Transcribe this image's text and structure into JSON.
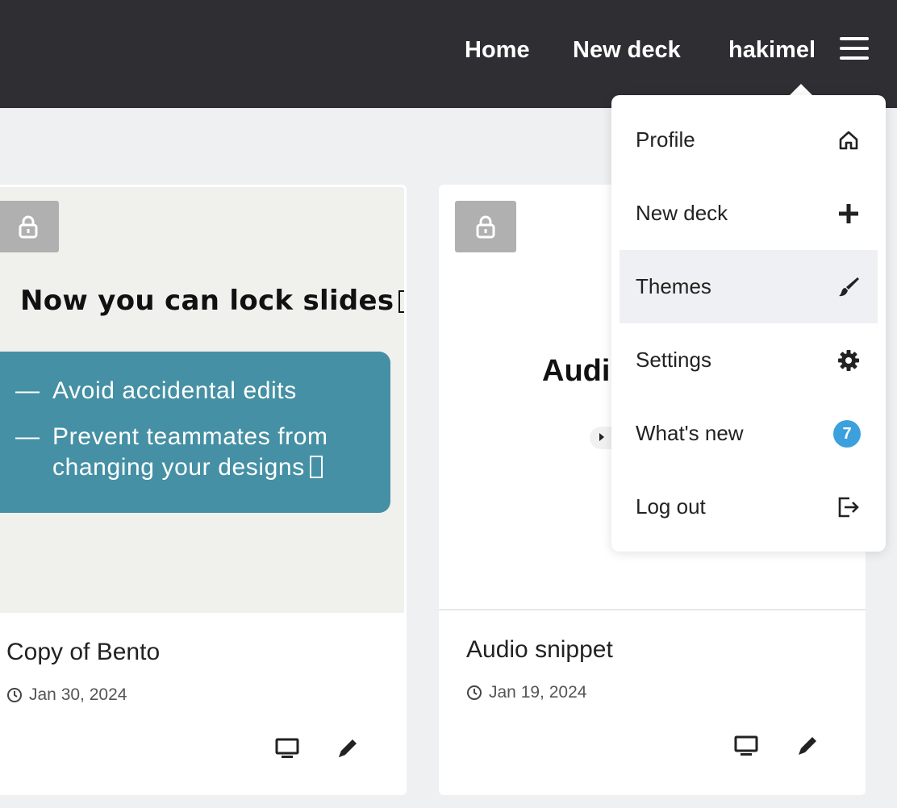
{
  "header": {
    "nav": {
      "home": "Home",
      "new_deck": "New deck",
      "username": "hakimel"
    },
    "menu_icon": "hamburger-menu-icon"
  },
  "decks": [
    {
      "title": "Copy of Bento",
      "date": "Jan 30, 2024",
      "locked": true,
      "thumbnail": {
        "heading": "Now you can lock slides",
        "bullets": [
          "Avoid accidental edits",
          "Prevent teammates from",
          "changing your designs"
        ],
        "background": "#f0f0ec",
        "box_color": "#4590a4"
      }
    },
    {
      "title": "Audio snippet",
      "date": "Jan 19, 2024",
      "locked": true,
      "thumbnail": {
        "heading": "Audi"
      }
    }
  ],
  "dropdown": {
    "items": [
      {
        "label": "Profile",
        "icon": "home-icon"
      },
      {
        "label": "New deck",
        "icon": "plus-icon"
      },
      {
        "label": "Themes",
        "icon": "brush-icon",
        "active": true
      },
      {
        "label": "Settings",
        "icon": "gear-icon"
      },
      {
        "label": "What's new",
        "icon": "badge",
        "badge": "7"
      },
      {
        "label": "Log out",
        "icon": "logout-icon"
      }
    ]
  },
  "colors": {
    "header_bg": "#2f2f33",
    "page_bg": "#eff0f2",
    "badge": "#3ba0dc",
    "lock_badge": "#b0b0b0"
  }
}
